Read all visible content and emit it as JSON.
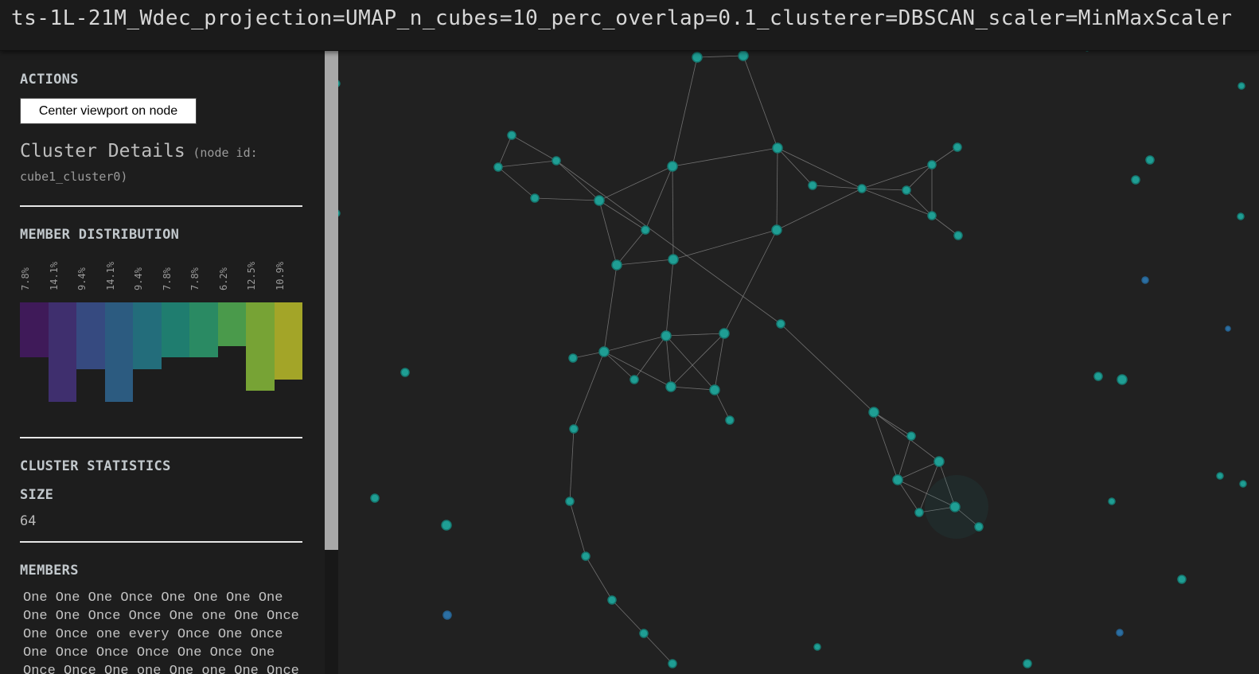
{
  "window": {
    "title": "ts-1L-21M_Wdec_projection=UMAP_n_cubes=10_perc_overlap=0.1_clusterer=DBSCAN_scaler=MinMaxScaler"
  },
  "sidebar": {
    "actions_heading": "ACTIONS",
    "center_button_label": "Center viewport on node",
    "cluster_details_title": "Cluster Details",
    "node_id_text": "(node id:",
    "node_id_value": "cube1_cluster0)",
    "member_distribution_heading": "MEMBER DISTRIBUTION",
    "distribution": {
      "percent_labels": [
        "7.8%",
        "14.1%",
        "9.4%",
        "14.1%",
        "9.4%",
        "7.8%",
        "7.8%",
        "6.2%",
        "12.5%",
        "10.9%"
      ],
      "values": [
        7.8,
        14.1,
        9.4,
        14.1,
        9.4,
        7.8,
        7.8,
        6.2,
        12.5,
        10.9
      ],
      "colors": [
        "#3f1a59",
        "#3f2f6e",
        "#364a80",
        "#2c5b80",
        "#236d7b",
        "#1f7d6f",
        "#2a8a63",
        "#4a9a4b",
        "#77a335",
        "#a3a528"
      ]
    },
    "cluster_statistics_heading": "CLUSTER STATISTICS",
    "size_label": "SIZE",
    "size_value": "64",
    "members_heading": "MEMBERS",
    "members_text": "One One One Once One One One One One One Once Once One one One Once One Once one every Once One Once One Once Once Once One Once One Once Once One one One one One Once"
  },
  "graph": {
    "node_color": "#1f9e94",
    "edge_color": "#8a8a8a",
    "highlight_node_color": "#2c6fa3"
  }
}
